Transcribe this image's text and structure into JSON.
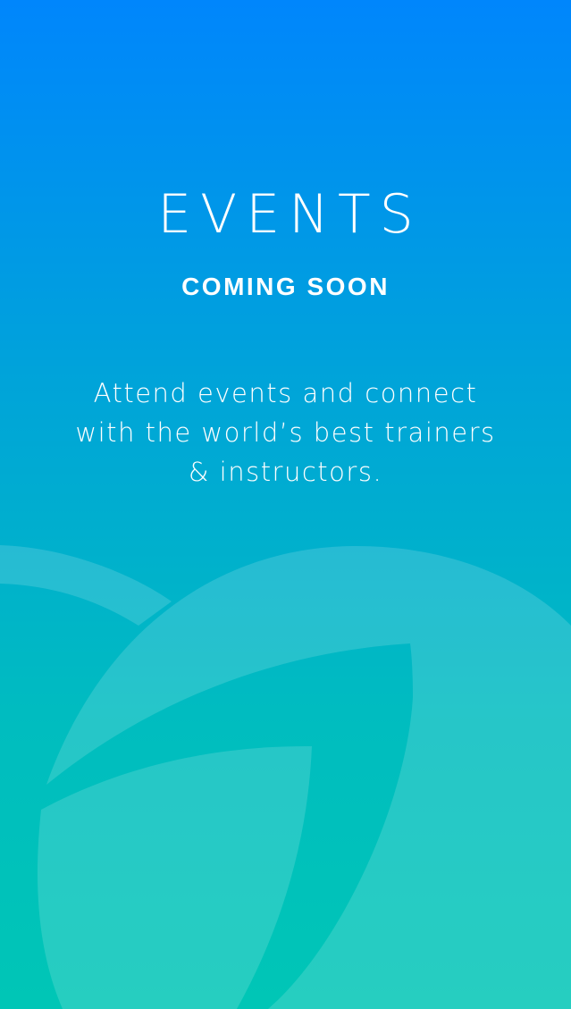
{
  "events_screen": {
    "title": "EVENTS",
    "subtitle": "COMING SOON",
    "description": "Attend events and connect with the world’s best trainers & instructors."
  },
  "background": {
    "gradient_top": "#0086fc",
    "gradient_bottom": "#00c6b6",
    "logo_mark_icon": "leaf-logo-icon"
  }
}
